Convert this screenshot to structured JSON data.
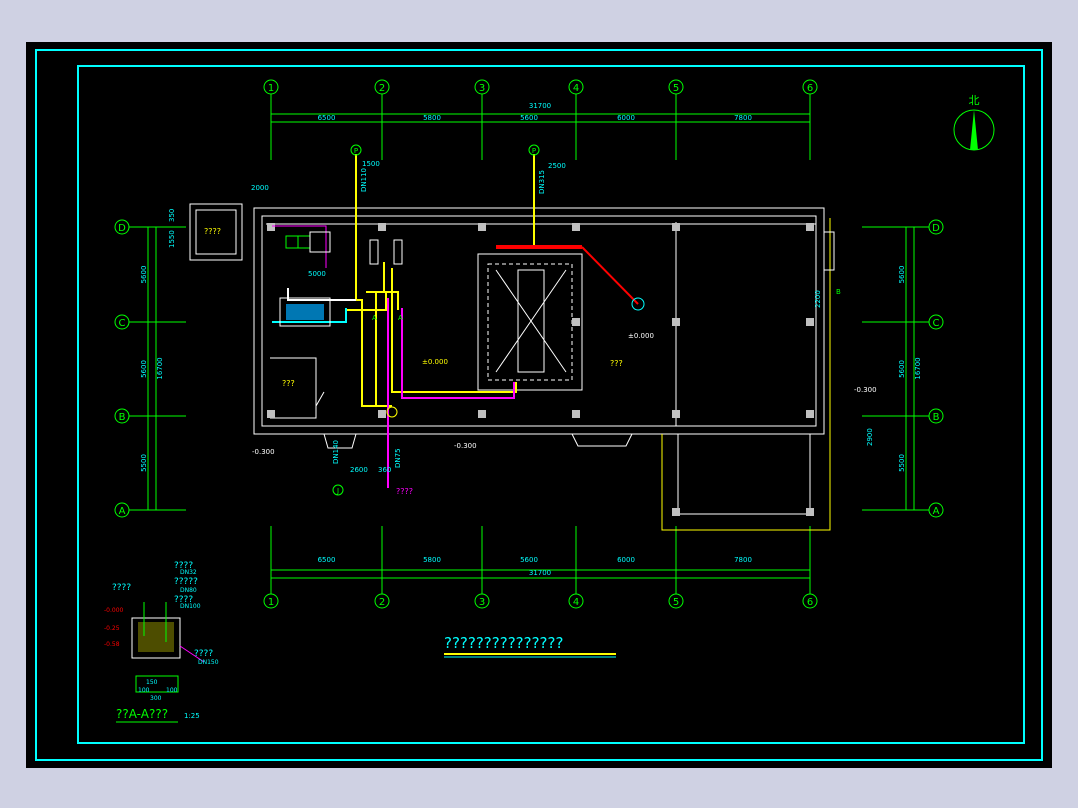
{
  "colors": {
    "background": "#000000",
    "border_cyan": "#00ffff",
    "grid_green": "#00ff00",
    "wall_white": "#ffffff",
    "pipe_yellow": "#ffff00",
    "pipe_magenta": "#ff00ff",
    "pipe_red": "#ff0000",
    "text_cyan": "#00ffff",
    "page_bg": "#cfd1e3"
  },
  "north": {
    "label": "北"
  },
  "axes": {
    "columns": [
      "1",
      "2",
      "3",
      "4",
      "5",
      "6"
    ],
    "rows": [
      "D",
      "C",
      "B",
      "A"
    ],
    "spacing_labels": [
      "6500",
      "5800",
      "5600",
      "6000",
      "7800"
    ],
    "total_length": "31700",
    "row_spacing_left": [
      "5600",
      "5600",
      "5500"
    ],
    "row_spacing_right": [
      "5600",
      "5600",
      "5500"
    ],
    "total_depth": "16700"
  },
  "annotations": {
    "dim_2000": "2000",
    "dim_1500": "1500",
    "dim_2500": "2500",
    "dim_5000": "5000",
    "dim_2600": "2600",
    "dim_360": "360",
    "dim_2200": "2200",
    "dim_2900": "2900",
    "dim_1550": "1550",
    "dim_350": "350",
    "pipe_dn110": "DN110",
    "pipe_dn315": "DN315",
    "pipe_dn140": "DN140",
    "pipe_dn75": "DN75",
    "pipe_dn50": "DN50",
    "pipe_dn100": "DN100",
    "level_0": "±0.000",
    "level_0b": "±0.000",
    "level_0c": "±0.000",
    "level_m300a": "-0.300",
    "level_m300b": "-0.300",
    "level_m300c": "-0.300",
    "room_small": "????",
    "room_left": "???",
    "room_pool": "???",
    "outlet_label": "????",
    "mark_a1": "A",
    "mark_a2": "A",
    "mark_b": "B",
    "mark_p1": "P",
    "mark_p2": "P",
    "mark_j": "J"
  },
  "drawing_title": "???????????????",
  "section": {
    "title": "??A-A???",
    "scale": "1:25",
    "labels": [
      "????",
      "????",
      "?????",
      "????",
      "????"
    ],
    "pipes": [
      "DN32",
      "DN80",
      "DN100",
      "DN150"
    ],
    "levels": [
      "-0.000",
      "-0.25",
      "-0.58"
    ],
    "dims": [
      "150",
      "100",
      "100",
      "300"
    ]
  }
}
